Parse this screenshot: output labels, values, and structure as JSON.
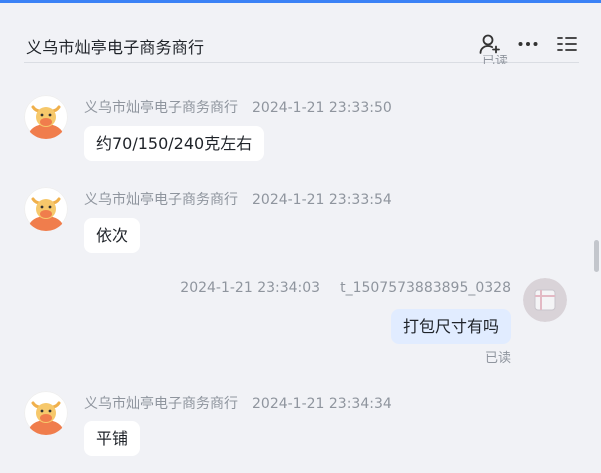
{
  "header": {
    "title": "义乌市灿亭电子商务商行",
    "icons": [
      "add-contact-icon",
      "more-icon",
      "menu-list-icon"
    ]
  },
  "peek_read": "已读",
  "messages": [
    {
      "sender": "义乌市灿亭电子商务商行",
      "time": "2024-1-21 23:33:50",
      "text": "约70/150/240克左右"
    },
    {
      "sender": "义乌市灿亭电子商务商行",
      "time": "2024-1-21 23:33:54",
      "text": "依次"
    },
    {
      "sender": "t_1507573883895_0328",
      "time": "2024-1-21 23:34:03",
      "text": "打包尺寸有吗",
      "status": "已读"
    },
    {
      "sender": "义乌市灿亭电子商务商行",
      "time": "2024-1-21 23:34:34",
      "text": "平铺"
    }
  ],
  "colors": {
    "accent": "#3b82f6",
    "my_bubble": "#e1ecff",
    "avatar_orange": "#f07d4c"
  }
}
